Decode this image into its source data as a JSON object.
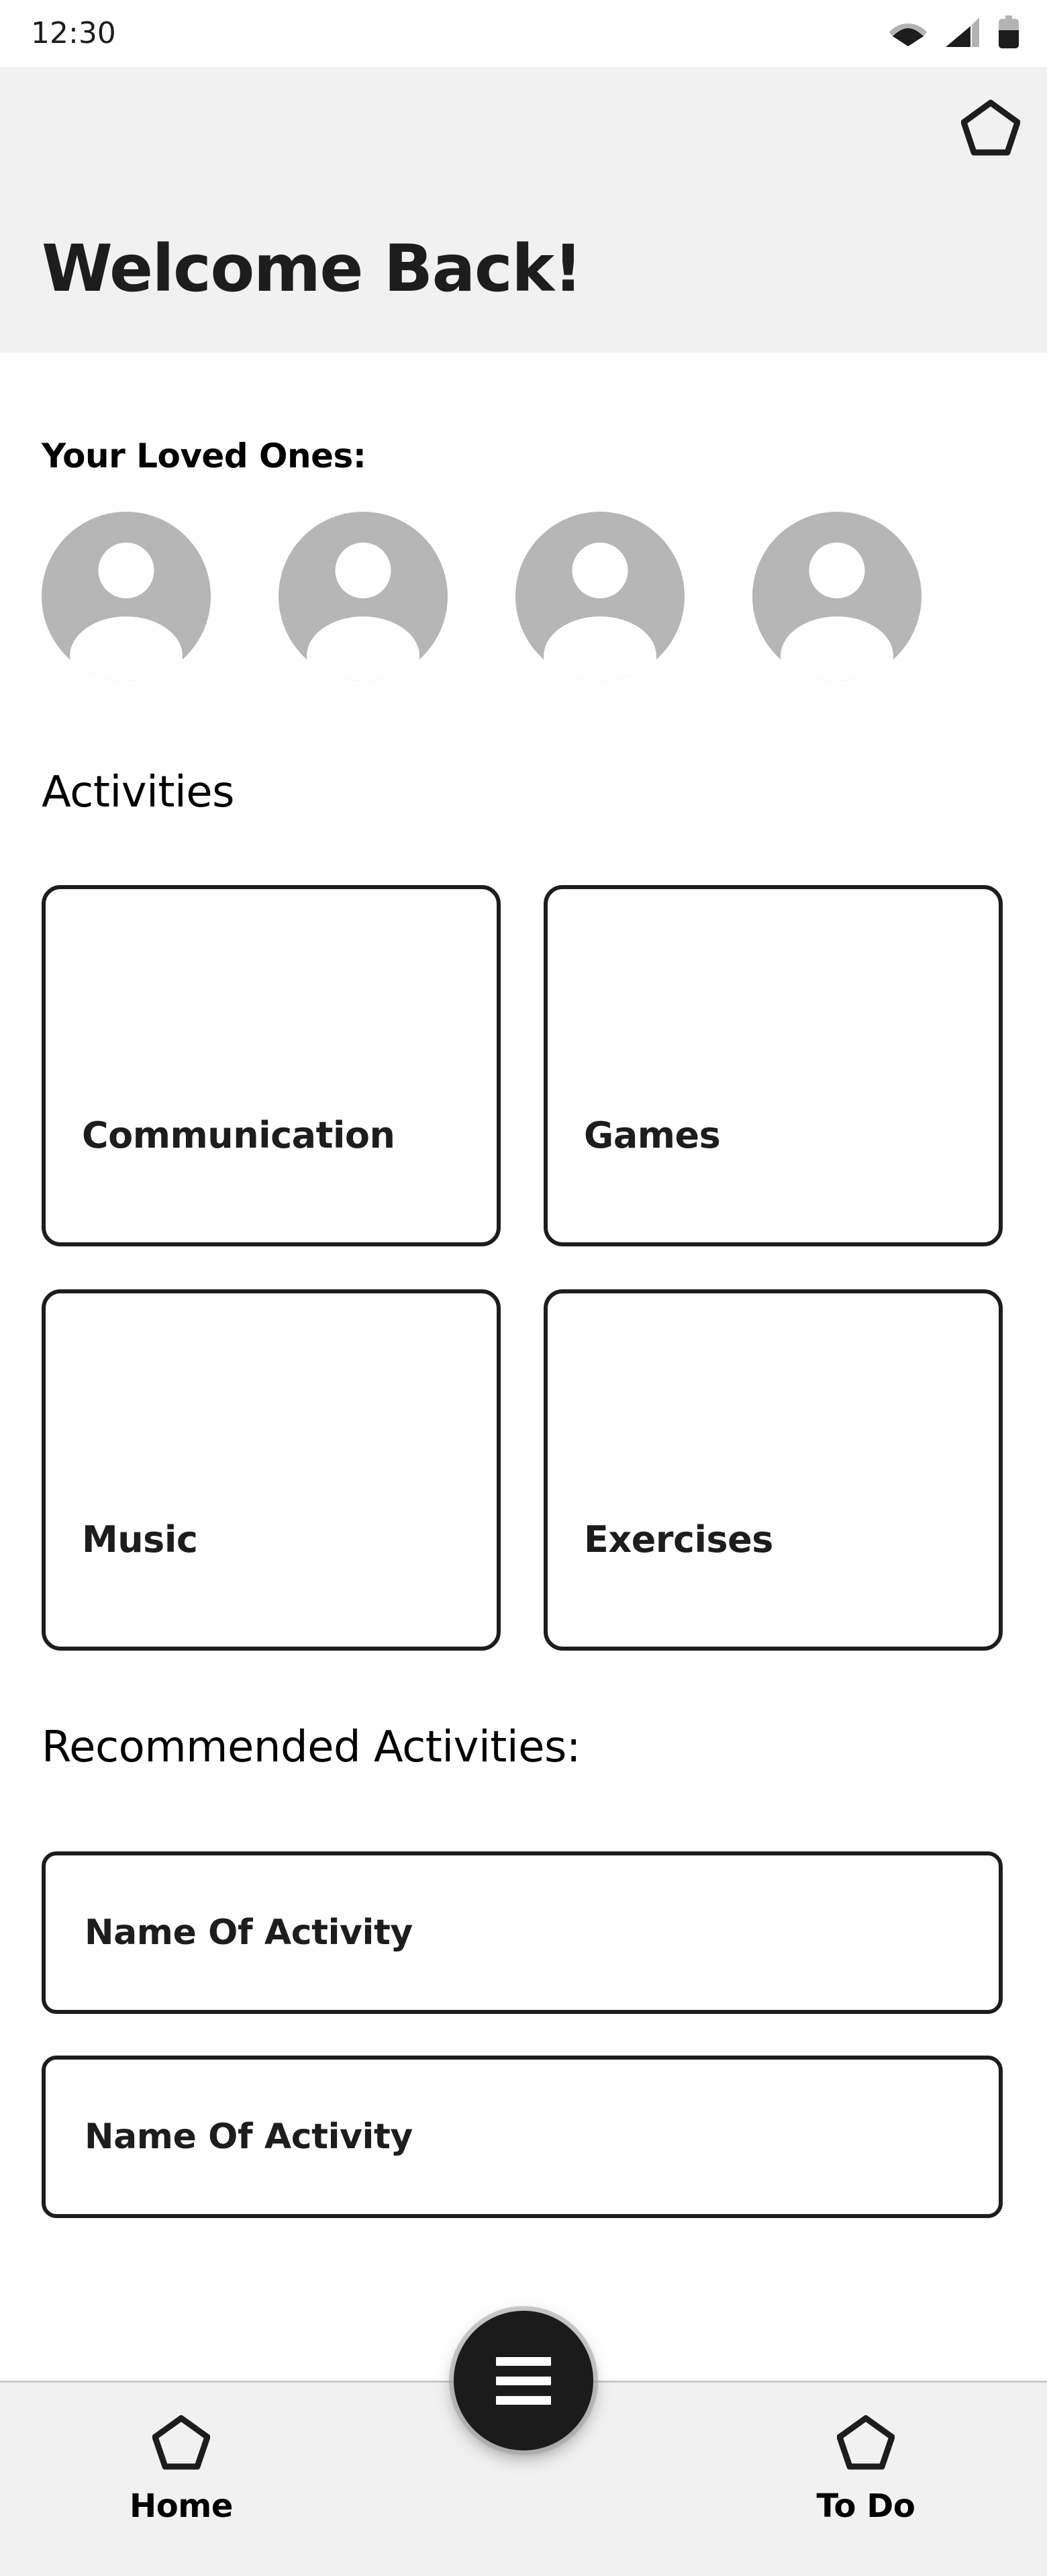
{
  "status_bar": {
    "time": "12:30",
    "icons": [
      "wifi-icon",
      "cellular-signal-icon",
      "battery-icon"
    ]
  },
  "header": {
    "title": "Welcome Back!",
    "action_icon": "pentagon-home-icon",
    "background_color": "#f1f1f1"
  },
  "loved_ones": {
    "label": "Your Loved Ones:",
    "avatars": [
      {
        "icon": "person-avatar-icon"
      },
      {
        "icon": "person-avatar-icon"
      },
      {
        "icon": "person-avatar-icon"
      },
      {
        "icon": "person-avatar-icon"
      }
    ],
    "avatar_color": "#b6b6b6"
  },
  "activities": {
    "heading": "Activities",
    "cards": [
      {
        "label": "Communication"
      },
      {
        "label": "Games"
      },
      {
        "label": "Music"
      },
      {
        "label": "Exercises"
      }
    ]
  },
  "recommended": {
    "heading": "Recommended Activities:",
    "items": [
      {
        "label": "Name Of Activity"
      },
      {
        "label": "Name Of Activity"
      }
    ]
  },
  "fab": {
    "icon": "hamburger-menu-icon",
    "color": "#1b1b1b"
  },
  "bottom_nav": {
    "background_color": "#f1f1f1",
    "items": [
      {
        "label": "Home",
        "icon": "pentagon-home-icon"
      },
      {
        "label": "To Do",
        "icon": "pentagon-todo-icon"
      }
    ]
  }
}
